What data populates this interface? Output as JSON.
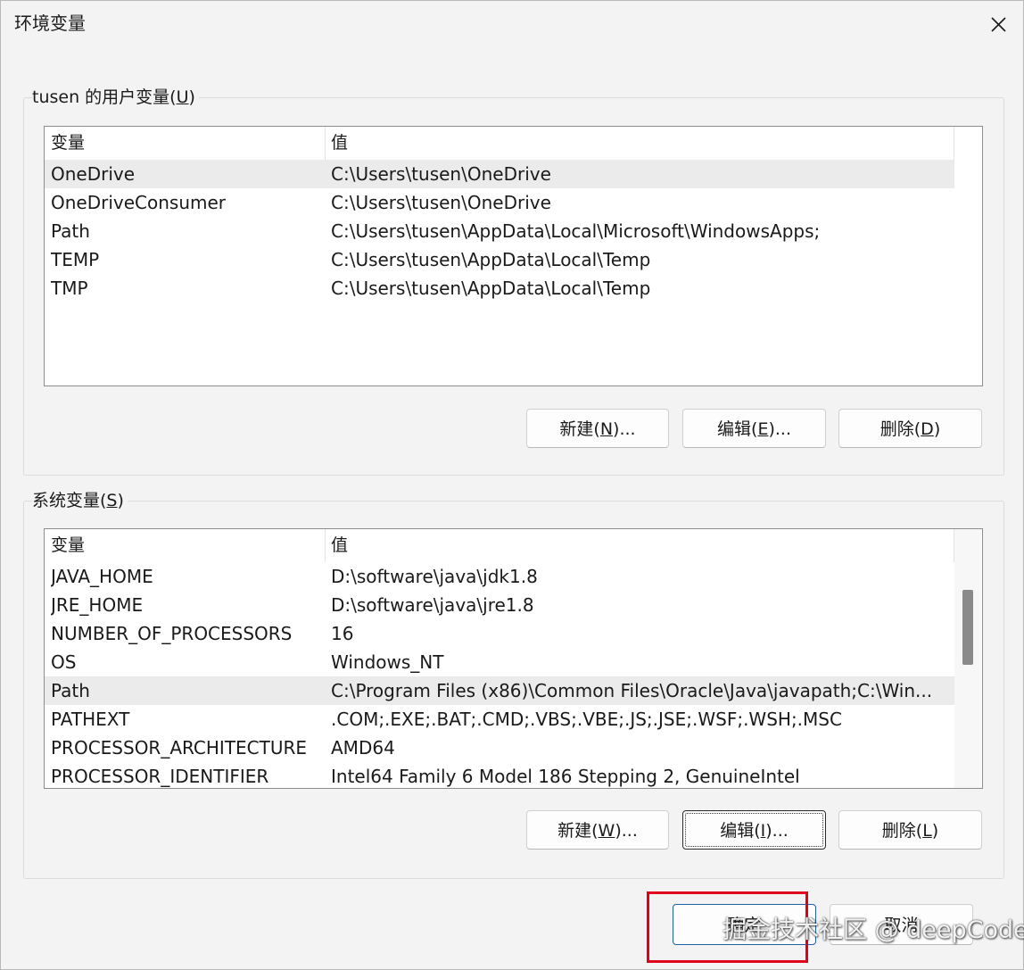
{
  "window": {
    "title": "环境变量",
    "close_icon": "close-icon"
  },
  "user_group": {
    "label_prefix": "tusen 的用户变量(",
    "label_key": "U",
    "label_suffix": ")",
    "columns": [
      "变量",
      "值"
    ],
    "rows": [
      {
        "name": "OneDrive",
        "value": "C:\\Users\\tusen\\OneDrive",
        "selected": true
      },
      {
        "name": "OneDriveConsumer",
        "value": "C:\\Users\\tusen\\OneDrive",
        "selected": false
      },
      {
        "name": "Path",
        "value": "C:\\Users\\tusen\\AppData\\Local\\Microsoft\\WindowsApps;",
        "selected": false
      },
      {
        "name": "TEMP",
        "value": "C:\\Users\\tusen\\AppData\\Local\\Temp",
        "selected": false
      },
      {
        "name": "TMP",
        "value": "C:\\Users\\tusen\\AppData\\Local\\Temp",
        "selected": false
      }
    ],
    "buttons": {
      "new": {
        "pre": "新建(",
        "key": "N",
        "post": ")..."
      },
      "edit": {
        "pre": "编辑(",
        "key": "E",
        "post": ")..."
      },
      "delete": {
        "pre": "删除(",
        "key": "D",
        "post": ")"
      }
    }
  },
  "system_group": {
    "label_prefix": "系统变量(",
    "label_key": "S",
    "label_suffix": ")",
    "columns": [
      "变量",
      "值"
    ],
    "rows": [
      {
        "name": "JAVA_HOME",
        "value": "D:\\software\\java\\jdk1.8",
        "selected": false
      },
      {
        "name": "JRE_HOME",
        "value": "D:\\software\\java\\jre1.8",
        "selected": false
      },
      {
        "name": "NUMBER_OF_PROCESSORS",
        "value": "16",
        "selected": false
      },
      {
        "name": "OS",
        "value": "Windows_NT",
        "selected": false
      },
      {
        "name": "Path",
        "value": "C:\\Program Files (x86)\\Common Files\\Oracle\\Java\\javapath;C:\\Win...",
        "selected": true
      },
      {
        "name": "PATHEXT",
        "value": ".COM;.EXE;.BAT;.CMD;.VBS;.VBE;.JS;.JSE;.WSF;.WSH;.MSC",
        "selected": false
      },
      {
        "name": "PROCESSOR_ARCHITECTURE",
        "value": "AMD64",
        "selected": false
      },
      {
        "name": "PROCESSOR_IDENTIFIER",
        "value": "Intel64 Family 6 Model 186 Stepping 2, GenuineIntel",
        "selected": false
      }
    ],
    "scroll_position_fraction": 0.3,
    "buttons": {
      "new": {
        "pre": "新建(",
        "key": "W",
        "post": ")..."
      },
      "edit": {
        "pre": "编辑(",
        "key": "I",
        "post": ")..."
      },
      "delete": {
        "pre": "删除(",
        "key": "L",
        "post": ")"
      }
    }
  },
  "footer": {
    "ok_label": "确定",
    "cancel_label": "取消"
  },
  "annotation": {
    "highlight_color": "#e0001b"
  },
  "watermark": {
    "text": "掘金技术社区 @ deepCode"
  }
}
